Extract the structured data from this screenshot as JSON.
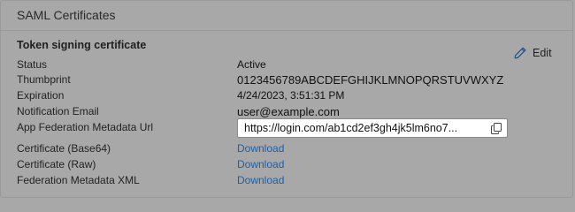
{
  "section": {
    "title": "SAML Certificates"
  },
  "certificate": {
    "heading": "Token signing certificate",
    "edit_label": "Edit",
    "edit_icon": "pencil-icon",
    "copy_icon": "copy-icon",
    "rows": {
      "status": {
        "label": "Status",
        "value": "Active"
      },
      "thumbprint": {
        "label": "Thumbprint",
        "value": "0123456789ABCDEFGHIJKLMNOPQRSTUVWXYZ"
      },
      "expiration": {
        "label": "Expiration",
        "value": "4/24/2023, 3:51:31 PM"
      },
      "notification_email": {
        "label": "Notification Email",
        "value": "user@example.com"
      },
      "metadata_url": {
        "label": "App Federation Metadata Url",
        "value": "https://login.com/ab1cd2ef3gh4jk5lm6no7..."
      },
      "cert_base64": {
        "label": "Certificate (Base64)",
        "value": "Download"
      },
      "cert_raw": {
        "label": "Certificate (Raw)",
        "value": "Download"
      },
      "federation_xml": {
        "label": "Federation Metadata XML",
        "value": "Download"
      }
    }
  },
  "colors": {
    "background": "#a8a8a8",
    "link": "#1f5fa8"
  }
}
